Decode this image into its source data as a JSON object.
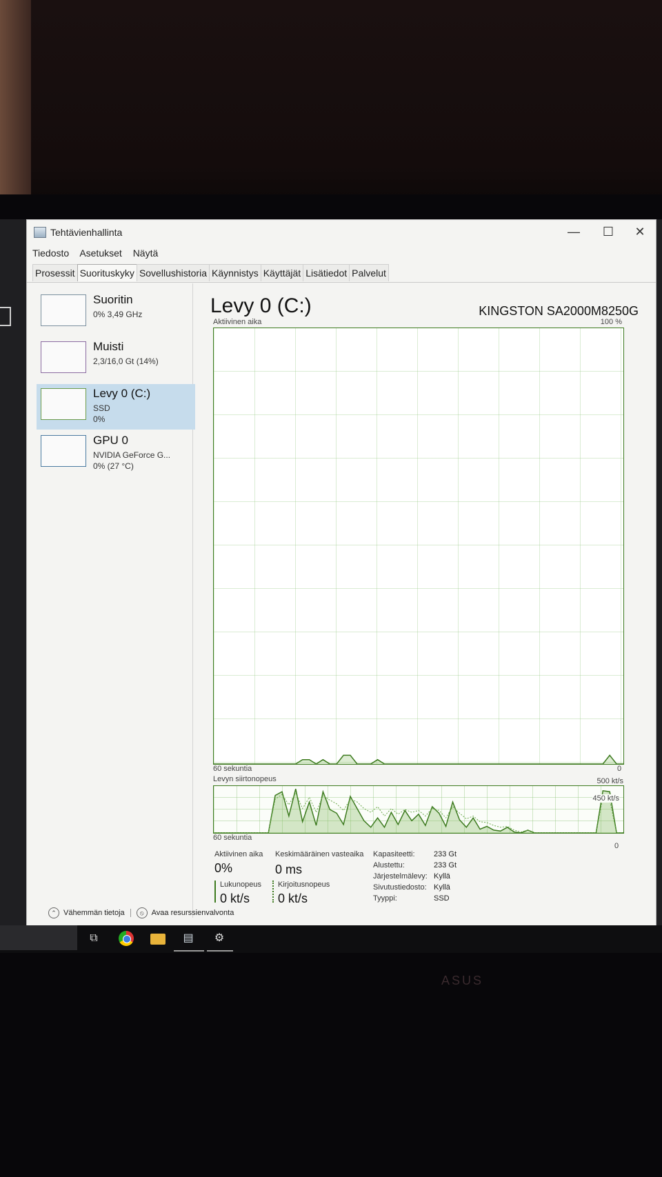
{
  "window": {
    "title": "Tehtävienhallinta",
    "controls": {
      "minimize": "—",
      "maximize": "☐",
      "close": "✕"
    }
  },
  "menu": [
    "Tiedosto",
    "Asetukset",
    "Näytä"
  ],
  "tabs": [
    {
      "label": "Prosessit",
      "active": false
    },
    {
      "label": "Suorituskyky",
      "active": true
    },
    {
      "label": "Sovellushistoria",
      "active": false
    },
    {
      "label": "Käynnistys",
      "active": false
    },
    {
      "label": "Käyttäjät",
      "active": false
    },
    {
      "label": "Lisätiedot",
      "active": false
    },
    {
      "label": "Palvelut",
      "active": false
    }
  ],
  "sidebar": {
    "items": [
      {
        "name": "Suoritin",
        "line1": "0% 3,49 GHz",
        "line2": ""
      },
      {
        "name": "Muisti",
        "line1": "2,3/16,0 Gt (14%)",
        "line2": ""
      },
      {
        "name": "Levy 0 (C:)",
        "line1": "SSD",
        "line2": "0%"
      },
      {
        "name": "GPU 0",
        "line1": "NVIDIA GeForce G...",
        "line2": "0% (27 °C)"
      }
    ]
  },
  "main": {
    "title": "Levy 0 (C:)",
    "model": "KINGSTON SA2000M8250G",
    "active_time_label": "Aktiivinen aika",
    "active_time_max": "100 %",
    "active_time_time": "60 sekuntia",
    "active_time_min": "0",
    "transfer_label": "Levyn siirtonopeus",
    "transfer_max": "500 kt/s",
    "transfer_mark": "450 kt/s",
    "transfer_time": "60 sekuntia",
    "transfer_min": "0"
  },
  "stats": {
    "active_time_label": "Aktiivinen aika",
    "active_time_value": "0%",
    "response_label": "Keskimääräinen vasteaika",
    "response_value": "0 ms",
    "read_label": "Lukunopeus",
    "read_value": "0 kt/s",
    "write_label": "Kirjoitusnopeus",
    "write_value": "0 kt/s"
  },
  "info": [
    {
      "key": "Kapasiteetti:",
      "value": "233 Gt"
    },
    {
      "key": "Alustettu:",
      "value": "233 Gt"
    },
    {
      "key": "Järjestelmälevy:",
      "value": "Kyllä"
    },
    {
      "key": "Sivutustiedosto:",
      "value": "Kyllä"
    },
    {
      "key": "Tyyppi:",
      "value": "SSD"
    }
  ],
  "footer": {
    "fewer_details": "Vähemmän tietoja",
    "resource_monitor": "Avaa resurssienvalvonta"
  },
  "taskbar": {
    "icons": [
      "task-view-icon",
      "chrome-icon",
      "file-explorer-icon",
      "task-manager-icon",
      "settings-icon"
    ]
  },
  "brand": "ASUS",
  "chart_data": [
    {
      "type": "line",
      "title": "Aktiivinen aika",
      "x": [
        0,
        1,
        2,
        3,
        4,
        5,
        6,
        7,
        8,
        9,
        10,
        11,
        12,
        13,
        14,
        15,
        16,
        17,
        18,
        19,
        20,
        21,
        22,
        23,
        24,
        25,
        26,
        27,
        28,
        29,
        30,
        31,
        32,
        33,
        34,
        35,
        36,
        37,
        38,
        39,
        40,
        41,
        42,
        43,
        44,
        45,
        46,
        47,
        48,
        49,
        50,
        51,
        52,
        53,
        54,
        55,
        56,
        57,
        58,
        59,
        60
      ],
      "series": [
        {
          "values": [
            0,
            0,
            0,
            0,
            0,
            0,
            0,
            0,
            0,
            0,
            0,
            0,
            0,
            1,
            1,
            0,
            1,
            0,
            0,
            2,
            2,
            0,
            0,
            0,
            1,
            0,
            0,
            0,
            0,
            0,
            0,
            0,
            0,
            0,
            0,
            0,
            0,
            0,
            0,
            0,
            0,
            0,
            0,
            0,
            0,
            0,
            0,
            0,
            0,
            0,
            0,
            0,
            0,
            0,
            0,
            0,
            0,
            0,
            2,
            0,
            0
          ]
        }
      ],
      "ylim": [
        0,
        100
      ]
    },
    {
      "type": "line",
      "title": "Levyn siirtonopeus",
      "x": [
        0,
        1,
        2,
        3,
        4,
        5,
        6,
        7,
        8,
        9,
        10,
        11,
        12,
        13,
        14,
        15,
        16,
        17,
        18,
        19,
        20,
        21,
        22,
        23,
        24,
        25,
        26,
        27,
        28,
        29,
        30,
        31,
        32,
        33,
        34,
        35,
        36,
        37,
        38,
        39,
        40,
        41,
        42,
        43,
        44,
        45,
        46,
        47,
        48,
        49,
        50,
        51,
        52,
        53,
        54,
        55,
        56,
        57,
        58,
        59,
        60
      ],
      "series": [
        {
          "values": [
            0,
            0,
            0,
            0,
            0,
            0,
            0,
            0,
            0,
            400,
            440,
            180,
            470,
            120,
            330,
            80,
            440,
            250,
            210,
            90,
            390,
            260,
            130,
            60,
            160,
            60,
            220,
            90,
            240,
            130,
            200,
            80,
            280,
            210,
            70,
            330,
            140,
            60,
            160,
            40,
            70,
            30,
            20,
            60,
            10,
            0,
            30,
            0,
            0,
            0,
            0,
            0,
            0,
            0,
            0,
            0,
            0,
            450,
            440,
            0,
            0
          ]
        },
        {
          "values": [
            0,
            0,
            0,
            0,
            0,
            0,
            0,
            0,
            0,
            360,
            410,
            300,
            430,
            260,
            380,
            220,
            400,
            350,
            310,
            240,
            360,
            330,
            260,
            220,
            280,
            180,
            260,
            200,
            250,
            220,
            240,
            180,
            260,
            240,
            160,
            280,
            210,
            150,
            180,
            120,
            110,
            80,
            60,
            70,
            30,
            10,
            30,
            0,
            0,
            0,
            0,
            0,
            0,
            0,
            0,
            0,
            0,
            380,
            350,
            0,
            0
          ]
        }
      ],
      "ylim": [
        0,
        500
      ]
    }
  ]
}
